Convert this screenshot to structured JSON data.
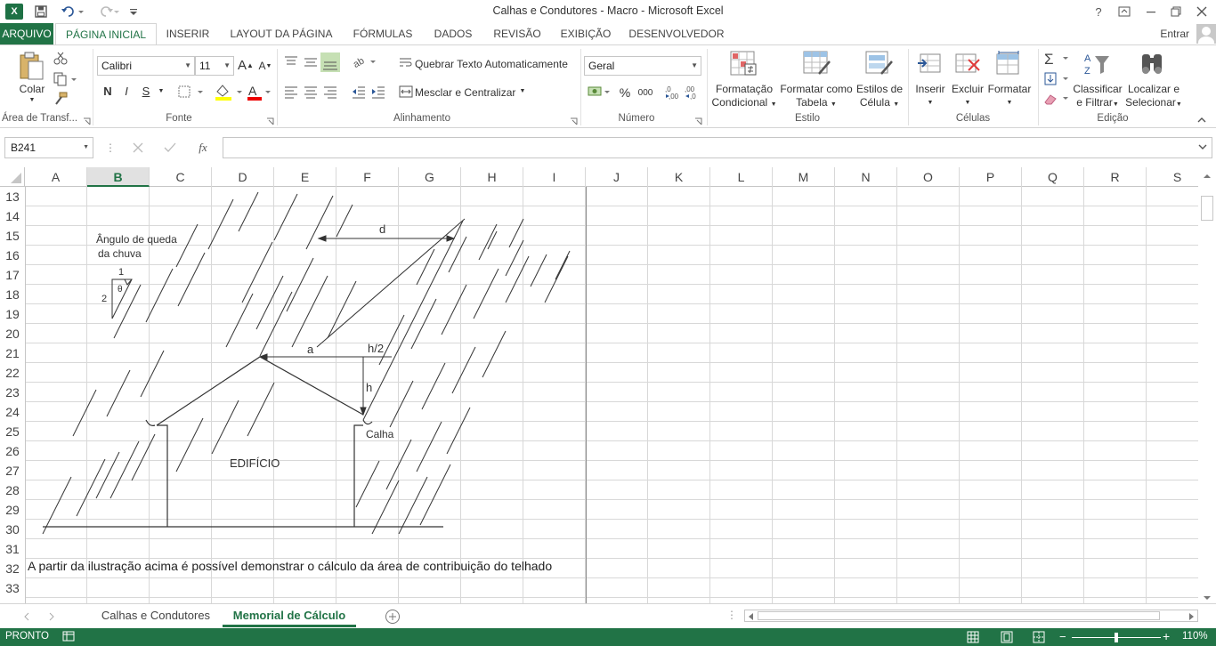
{
  "window": {
    "title": "Calhas e Condutores - Macro - Microsoft Excel",
    "app_icon_letter": "X",
    "help_glyph": "?",
    "user_label": "Entrar"
  },
  "ribbon_tabs": [
    "ARQUIVO",
    "PÁGINA INICIAL",
    "INSERIR",
    "LAYOUT DA PÁGINA",
    "FÓRMULAS",
    "DADOS",
    "REVISÃO",
    "EXIBIÇÃO",
    "DESENVOLVEDOR"
  ],
  "ribbon": {
    "clipboard": {
      "paste_label": "Colar",
      "group_label": "Área de Transf..."
    },
    "font": {
      "font_name": "Calibri",
      "font_size": "11",
      "bold": "N",
      "italic": "I",
      "underline": "S",
      "grow": "A",
      "shrink": "A",
      "group_label": "Fonte"
    },
    "alignment": {
      "wrap_text": "Quebrar Texto Automaticamente",
      "merge_center": "Mesclar e Centralizar",
      "group_label": "Alinhamento"
    },
    "number": {
      "format": "Geral",
      "percent": "%",
      "thousands": "000",
      "inc_decimal": ",0\n,00",
      "group_label": "Número"
    },
    "styles": {
      "conditional_line1": "Formatação",
      "conditional_line2": "Condicional",
      "table_line1": "Formatar como",
      "table_line2": "Tabela",
      "cell_line1": "Estilos de",
      "cell_line2": "Célula",
      "group_label": "Estilo"
    },
    "cells": {
      "insert": "Inserir",
      "delete": "Excluir",
      "format": "Formatar",
      "group_label": "Células"
    },
    "editing": {
      "sort_line1": "Classificar",
      "sort_line2": "e Filtrar",
      "find_line1": "Localizar e",
      "find_line2": "Selecionar",
      "group_label": "Edição"
    }
  },
  "formula_bar": {
    "name_box": "B241",
    "fx": "fx",
    "formula": ""
  },
  "columns": [
    "A",
    "B",
    "C",
    "D",
    "E",
    "F",
    "G",
    "H",
    "I",
    "J",
    "K",
    "L",
    "M",
    "N",
    "O",
    "P",
    "Q",
    "R",
    "S"
  ],
  "selected_column": "B",
  "rows": [
    "13",
    "14",
    "15",
    "16",
    "17",
    "18",
    "19",
    "20",
    "21",
    "22",
    "23",
    "24",
    "25",
    "26",
    "27",
    "28",
    "29",
    "30",
    "31",
    "32",
    "33"
  ],
  "cell_text_row32": "A partir da ilustração acima é possível demonstrar o cálculo da área de contribuição do telhado",
  "diagram": {
    "rain_angle_line1": "Ângulo de queda",
    "rain_angle_line2": "da chuva",
    "ratio_top": "1",
    "ratio_side": "2",
    "theta": "θ",
    "label_d": "d",
    "label_a": "a",
    "label_h2": "h/2",
    "label_h": "h",
    "label_gutter": "Calha",
    "label_building": "EDIFÍCIO"
  },
  "sheet_tabs": [
    "Calhas e Condutores",
    "Memorial de Cálculo"
  ],
  "active_sheet": "Memorial de Cálculo",
  "status": {
    "ready": "PRONTO",
    "zoom": "110%"
  }
}
